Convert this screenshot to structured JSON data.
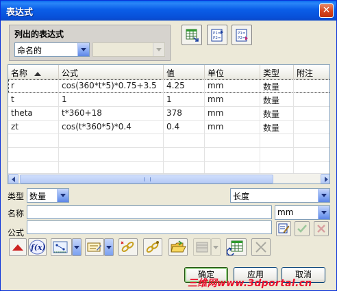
{
  "window": {
    "title": "表达式",
    "close_glyph": "✕"
  },
  "list_group": {
    "label": "列出的表达式",
    "filter_select": "命名的",
    "second_select": ""
  },
  "toolbar_top": [
    {
      "name": "export-spreadsheet-icon"
    },
    {
      "name": "list-expressions-icon",
      "text": "P1=\nP2="
    },
    {
      "name": "list-expressions-arrow-icon",
      "text": "P1=\nP2="
    }
  ],
  "table": {
    "columns": [
      "名称",
      "公式",
      "值",
      "单位",
      "类型",
      "附注"
    ],
    "rows": [
      [
        "r",
        "cos(360*t*5)*0.75+3.5",
        "4.25",
        "mm",
        "数量",
        ""
      ],
      [
        "t",
        "1",
        "1",
        "mm",
        "数量",
        ""
      ],
      [
        "theta",
        "t*360+18",
        "378",
        "mm",
        "数量",
        ""
      ],
      [
        "zt",
        "cos(t*360*5)*0.4",
        "0.4",
        "mm",
        "数量",
        ""
      ]
    ]
  },
  "form": {
    "type_label": "类型",
    "type_value": "数量",
    "dimension_value": "长度",
    "name_label": "名称",
    "name_value": "",
    "unit_value": "mm",
    "formula_label": "公式",
    "formula_value": ""
  },
  "toolbar_bottom": {
    "fx_label": "f(x)"
  },
  "buttons": {
    "ok": "确定",
    "apply": "应用",
    "cancel": "取消"
  },
  "watermark": "三维网www.3dportal.cn",
  "colors": {
    "title_bar": "#0a5ee8",
    "accent_green": "#2f9a2f",
    "accent_red": "#cc2222"
  }
}
